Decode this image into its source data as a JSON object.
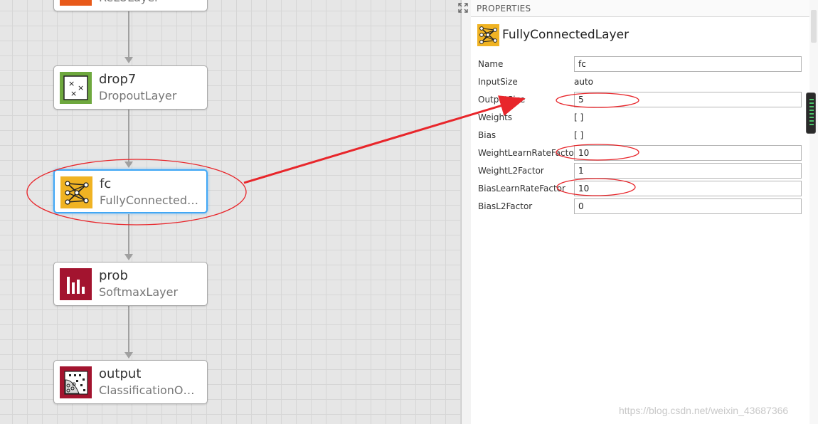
{
  "canvas": {
    "layers": [
      {
        "name": "",
        "type": "ReLULayer",
        "color": "#e85a1a"
      },
      {
        "name": "drop7",
        "type": "DropoutLayer",
        "color": "#6ea83e"
      },
      {
        "name": "fc",
        "type": "FullyConnected…",
        "color": "#f0b323"
      },
      {
        "name": "prob",
        "type": "SoftmaxLayer",
        "color": "#a3142f"
      },
      {
        "name": "output",
        "type": "ClassificationO…",
        "color": "#a3142f"
      }
    ]
  },
  "panel": {
    "header": "PROPERTIES",
    "layer_title": "FullyConnectedLayer",
    "props": [
      {
        "label": "Name",
        "value": "fc",
        "editable": true
      },
      {
        "label": "InputSize",
        "value": "auto",
        "editable": false
      },
      {
        "label": "OutputSize",
        "value": "5",
        "editable": true
      },
      {
        "label": "Weights",
        "value": "[ ]",
        "editable": false
      },
      {
        "label": "Bias",
        "value": "[ ]",
        "editable": false
      },
      {
        "label": "WeightLearnRateFactor",
        "value": "10",
        "editable": true
      },
      {
        "label": "WeightL2Factor",
        "value": "1",
        "editable": true
      },
      {
        "label": "BiasLearnRateFactor",
        "value": "10",
        "editable": true
      },
      {
        "label": "BiasL2Factor",
        "value": "0",
        "editable": true
      }
    ]
  },
  "watermark": "https://blog.csdn.net/weixin_43687366",
  "annotation_color": "#e8262b"
}
